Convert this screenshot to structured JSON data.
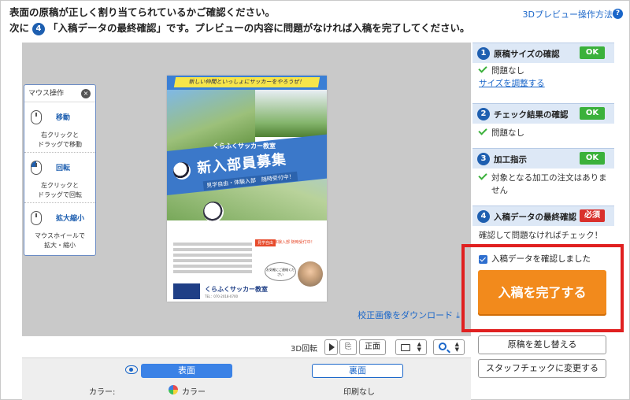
{
  "instructions": {
    "line1": "表面の原稿が正しく割り当てられているかご確認ください。",
    "line2_prefix": "次に",
    "line2_step": "4",
    "line2_rest": "「入稿データの最終確認」です。プレビューの内容に問題がなければ入稿を完了してください。"
  },
  "help": {
    "label": "3Dプレビュー操作方法",
    "icon": "?"
  },
  "mouse_panel": {
    "title": "マウス操作",
    "close_icon": "×",
    "sections": [
      {
        "name": "移動",
        "desc1": "右クリックと",
        "desc2": "ドラッグで移動"
      },
      {
        "name": "回転",
        "desc1": "左クリックと",
        "desc2": "ドラッグで回転"
      },
      {
        "name": "拡大縮小",
        "desc1": "マウスホイールで",
        "desc2": "拡大・縮小"
      }
    ]
  },
  "poster": {
    "banner": "新しい仲間といっしょにサッカーをやろうぜ！",
    "subtitle": "くらふくサッカー教室",
    "title": "新入部員募集",
    "ribbon": "見学自由・体験入部　随時受付中！",
    "tag": "見学自由",
    "tag2": "体験入部 随時受付中！",
    "bubble": "お気軽にご連絡ください",
    "footer_name": "くらふくサッカー教室",
    "footer_tel": "TEL：070-2018-0700"
  },
  "download_link": "校正画像をダウンロード",
  "toolbar": {
    "label_3d": "3D回転",
    "front_btn": "正面",
    "updown": "▲▼"
  },
  "faces": {
    "front": "表面",
    "back": "裏面",
    "color_label": "カラー:",
    "front_color": "カラー",
    "back_print": "印刷なし"
  },
  "steps": [
    {
      "num": "1",
      "title": "原稿サイズの確認",
      "badge": "OK",
      "status": "問題なし",
      "link": "サイズを調整する"
    },
    {
      "num": "2",
      "title": "チェック結果の確認",
      "badge": "OK",
      "status": "問題なし"
    },
    {
      "num": "3",
      "title": "加工指示",
      "badge": "OK",
      "status1": "対象となる加工の注文はありま",
      "status2": "せん"
    },
    {
      "num": "4",
      "title": "入稿データの最終確認",
      "badge": "必須",
      "status": "確認して問題なければチェック！"
    }
  ],
  "confirm": {
    "checkbox_label": "入稿データを確認しました",
    "checked": true,
    "complete_button": "入稿を完了する"
  },
  "side_buttons": {
    "replace": "原稿を差し替える",
    "staff_check": "スタッフチェックに変更する"
  },
  "colors": {
    "accent": "#1e5fb0",
    "ok": "#3bb13b",
    "required": "#d9302c",
    "complete": "#f28a1c",
    "highlight_border": "#e02020"
  }
}
